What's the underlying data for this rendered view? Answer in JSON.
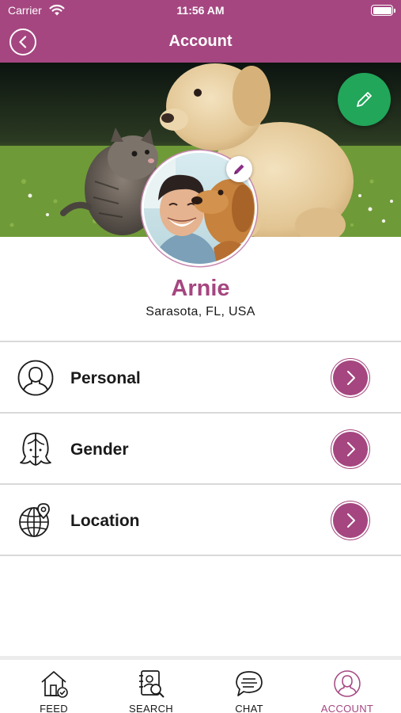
{
  "status_bar": {
    "carrier": "Carrier",
    "time": "11:56 AM"
  },
  "header": {
    "title": "Account",
    "back_icon": "chevron-left-icon"
  },
  "profile": {
    "name": "Arnie",
    "location": "Sarasota, FL, USA",
    "cover_edit_icon": "pencil-icon",
    "avatar_edit_icon": "pencil-icon"
  },
  "menu": {
    "items": [
      {
        "label": "Personal",
        "icon": "person-outline-icon"
      },
      {
        "label": "Gender",
        "icon": "gender-face-icon"
      },
      {
        "label": "Location",
        "icon": "globe-pin-icon"
      }
    ]
  },
  "tabbar": {
    "tabs": [
      {
        "label": "FEED",
        "icon": "home-check-icon",
        "active": false
      },
      {
        "label": "SEARCH",
        "icon": "contacts-search-icon",
        "active": false
      },
      {
        "label": "CHAT",
        "icon": "chat-bubble-icon",
        "active": false
      },
      {
        "label": "ACCOUNT",
        "icon": "account-circle-icon",
        "active": true
      }
    ]
  },
  "colors": {
    "brand": "#a54680",
    "edit_button": "#21a65a",
    "divider": "#d9d9d9"
  }
}
